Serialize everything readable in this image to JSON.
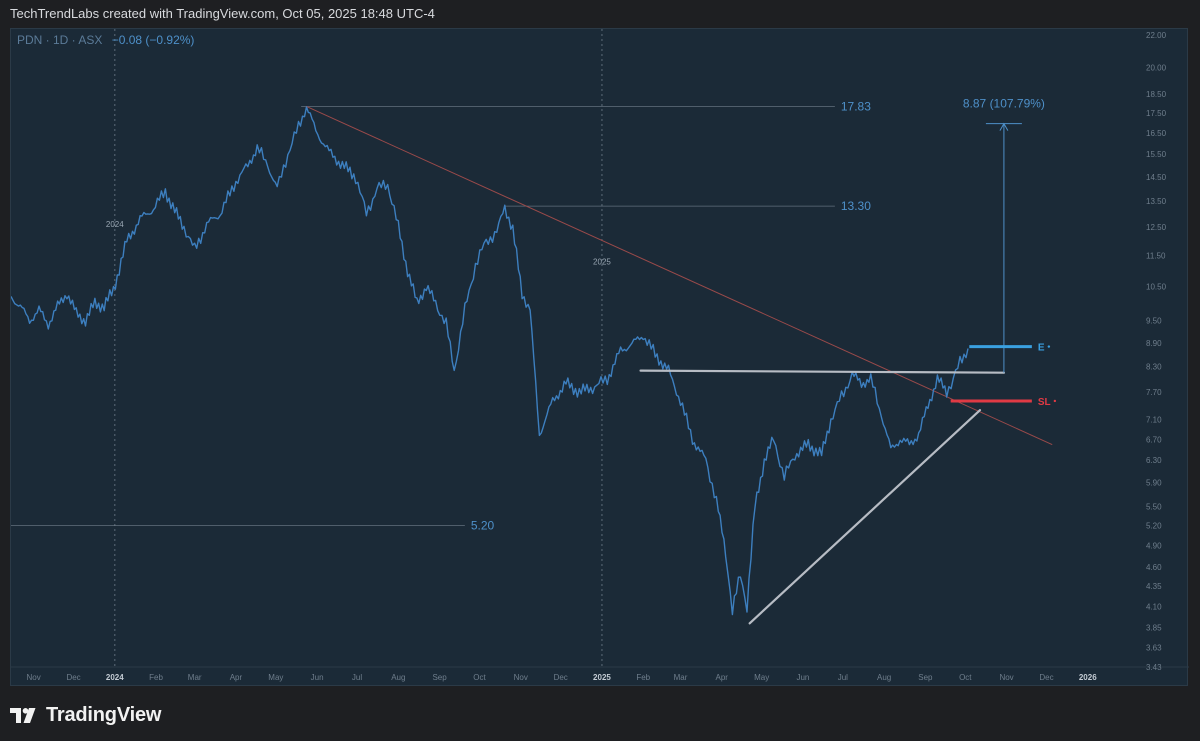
{
  "header": {
    "attribution": "TechTrendLabs created with TradingView.com, Oct 05, 2025 18:48 UTC-4"
  },
  "legend": {
    "symbol": "PDN · 1D · ASX",
    "change": "−0.08 (−0.92%)"
  },
  "brand": {
    "name": "TradingView",
    "icon": "tradingview-logo-icon"
  },
  "colors": {
    "background": "#1b2a37",
    "price_line": "#3d7fbf",
    "accent": "#4e90c9",
    "entry": "#3aa0e0",
    "stop": "#e03a44",
    "trendline": "#9a4a4a",
    "pattern_line": "#b7bcc4"
  },
  "chart_data": {
    "type": "line",
    "symbol": "PDN",
    "interval": "1D",
    "exchange": "ASX",
    "y_scale": "log",
    "ylim": [
      3.43,
      22.0
    ],
    "xlim": [
      "2023-10-15",
      "2026-02-10"
    ],
    "y_ticks": [
      3.43,
      3.63,
      3.85,
      4.1,
      4.35,
      4.6,
      4.9,
      5.2,
      5.5,
      5.9,
      6.3,
      6.7,
      7.1,
      7.7,
      8.3,
      8.9,
      9.5,
      10.5,
      11.5,
      12.5,
      13.5,
      14.5,
      15.5,
      16.5,
      17.5,
      18.5,
      20.0,
      22.0
    ],
    "y_tick_labels": [
      "3.43",
      "3.63",
      "3.85",
      "4.10",
      "4.35",
      "4.60",
      "4.90",
      "5.20",
      "5.50",
      "5.90",
      "6.30",
      "6.70",
      "7.10",
      "7.70",
      "8.30",
      "8.90",
      "9.50",
      "10.50",
      "11.50",
      "12.50",
      "13.50",
      "14.50",
      "15.50",
      "16.50",
      "17.50",
      "18.50",
      "20.00",
      "22.00"
    ],
    "x_ticks": [
      {
        "date": "2023-11-01",
        "label": "Nov"
      },
      {
        "date": "2023-12-01",
        "label": "Dec"
      },
      {
        "date": "2024-01-01",
        "label": "2024"
      },
      {
        "date": "2024-02-01",
        "label": "Feb"
      },
      {
        "date": "2024-03-01",
        "label": "Mar"
      },
      {
        "date": "2024-04-01",
        "label": "Apr"
      },
      {
        "date": "2024-05-01",
        "label": "May"
      },
      {
        "date": "2024-06-01",
        "label": "Jun"
      },
      {
        "date": "2024-07-01",
        "label": "Jul"
      },
      {
        "date": "2024-08-01",
        "label": "Aug"
      },
      {
        "date": "2024-09-01",
        "label": "Sep"
      },
      {
        "date": "2024-10-01",
        "label": "Oct"
      },
      {
        "date": "2024-11-01",
        "label": "Nov"
      },
      {
        "date": "2024-12-01",
        "label": "Dec"
      },
      {
        "date": "2025-01-01",
        "label": "2025"
      },
      {
        "date": "2025-02-01",
        "label": "Feb"
      },
      {
        "date": "2025-03-01",
        "label": "Mar"
      },
      {
        "date": "2025-04-01",
        "label": "Apr"
      },
      {
        "date": "2025-05-01",
        "label": "May"
      },
      {
        "date": "2025-06-01",
        "label": "Jun"
      },
      {
        "date": "2025-07-01",
        "label": "Jul"
      },
      {
        "date": "2025-08-01",
        "label": "Aug"
      },
      {
        "date": "2025-09-01",
        "label": "Sep"
      },
      {
        "date": "2025-10-01",
        "label": "Oct"
      },
      {
        "date": "2025-11-01",
        "label": "Nov"
      },
      {
        "date": "2025-12-01",
        "label": "Dec"
      },
      {
        "date": "2026-01-01",
        "label": "2026"
      }
    ],
    "year_markers": [
      {
        "date": "2024-01-01",
        "label": "2024",
        "price": 12.5
      },
      {
        "date": "2025-01-01",
        "label": "2025",
        "price": 11.2
      }
    ],
    "series": [
      {
        "points": [
          [
            "2023-10-15",
            10.2
          ],
          [
            "2023-10-22",
            9.9
          ],
          [
            "2023-10-29",
            9.5
          ],
          [
            "2023-11-05",
            9.8
          ],
          [
            "2023-11-12",
            9.4
          ],
          [
            "2023-11-19",
            9.9
          ],
          [
            "2023-11-26",
            10.3
          ],
          [
            "2023-12-03",
            9.7
          ],
          [
            "2023-12-10",
            9.5
          ],
          [
            "2023-12-17",
            10.0
          ],
          [
            "2023-12-24",
            9.9
          ],
          [
            "2023-12-31",
            10.4
          ],
          [
            "2024-01-10",
            12.0
          ],
          [
            "2024-01-20",
            12.8
          ],
          [
            "2024-01-30",
            13.2
          ],
          [
            "2024-02-08",
            13.9
          ],
          [
            "2024-02-15",
            13.1
          ],
          [
            "2024-02-22",
            12.5
          ],
          [
            "2024-03-01",
            11.7
          ],
          [
            "2024-03-10",
            12.6
          ],
          [
            "2024-03-20",
            13.0
          ],
          [
            "2024-04-01",
            14.3
          ],
          [
            "2024-04-10",
            15.0
          ],
          [
            "2024-04-17",
            15.8
          ],
          [
            "2024-04-25",
            15.0
          ],
          [
            "2024-05-02",
            14.0
          ],
          [
            "2024-05-10",
            15.5
          ],
          [
            "2024-05-18",
            16.8
          ],
          [
            "2024-05-24",
            17.83
          ],
          [
            "2024-05-31",
            16.6
          ],
          [
            "2024-06-10",
            15.6
          ],
          [
            "2024-06-20",
            15.0
          ],
          [
            "2024-06-30",
            14.5
          ],
          [
            "2024-07-08",
            13.0
          ],
          [
            "2024-07-16",
            14.0
          ],
          [
            "2024-07-24",
            14.2
          ],
          [
            "2024-08-01",
            12.5
          ],
          [
            "2024-08-08",
            11.0
          ],
          [
            "2024-08-15",
            10.0
          ],
          [
            "2024-08-22",
            10.5
          ],
          [
            "2024-08-29",
            10.0
          ],
          [
            "2024-09-06",
            9.4
          ],
          [
            "2024-09-12",
            8.2
          ],
          [
            "2024-09-20",
            9.8
          ],
          [
            "2024-09-28",
            11.2
          ],
          [
            "2024-10-06",
            12.0
          ],
          [
            "2024-10-14",
            12.3
          ],
          [
            "2024-10-20",
            13.3
          ],
          [
            "2024-10-26",
            12.4
          ],
          [
            "2024-11-02",
            10.3
          ],
          [
            "2024-11-08",
            9.8
          ],
          [
            "2024-11-15",
            6.8
          ],
          [
            "2024-11-25",
            7.5
          ],
          [
            "2024-12-05",
            7.9
          ],
          [
            "2024-12-15",
            7.7
          ],
          [
            "2024-12-25",
            7.8
          ],
          [
            "2025-01-05",
            8.0
          ],
          [
            "2025-01-15",
            8.7
          ],
          [
            "2025-01-25",
            8.9
          ],
          [
            "2025-02-01",
            9.1
          ],
          [
            "2025-02-10",
            8.6
          ],
          [
            "2025-02-20",
            8.2
          ],
          [
            "2025-03-01",
            7.5
          ],
          [
            "2025-03-10",
            6.7
          ],
          [
            "2025-03-20",
            6.3
          ],
          [
            "2025-03-28",
            5.6
          ],
          [
            "2025-04-04",
            4.8
          ],
          [
            "2025-04-09",
            4.05
          ],
          [
            "2025-04-15",
            4.5
          ],
          [
            "2025-04-20",
            4.1
          ],
          [
            "2025-04-26",
            5.5
          ],
          [
            "2025-05-03",
            6.3
          ],
          [
            "2025-05-10",
            6.7
          ],
          [
            "2025-05-18",
            6.0
          ],
          [
            "2025-05-26",
            6.4
          ],
          [
            "2025-06-05",
            6.6
          ],
          [
            "2025-06-15",
            6.4
          ],
          [
            "2025-06-22",
            7.1
          ],
          [
            "2025-06-30",
            7.6
          ],
          [
            "2025-07-08",
            8.1
          ],
          [
            "2025-07-15",
            7.9
          ],
          [
            "2025-07-22",
            8.0
          ],
          [
            "2025-07-30",
            7.2
          ],
          [
            "2025-08-06",
            6.5
          ],
          [
            "2025-08-13",
            6.7
          ],
          [
            "2025-08-20",
            6.6
          ],
          [
            "2025-08-27",
            6.8
          ],
          [
            "2025-09-03",
            7.4
          ],
          [
            "2025-09-10",
            8.0
          ],
          [
            "2025-09-17",
            7.7
          ],
          [
            "2025-09-22",
            8.0
          ],
          [
            "2025-09-27",
            8.4
          ],
          [
            "2025-10-03",
            8.75
          ]
        ]
      }
    ],
    "horizontal_levels": [
      {
        "price": 17.83,
        "label": "17.83",
        "from": "2024-05-20",
        "to": "2025-06-25"
      },
      {
        "price": 13.3,
        "label": "13.30",
        "from": "2024-10-20",
        "to": "2025-06-25"
      },
      {
        "price": 5.2,
        "label": "5.20",
        "from": "2023-10-15",
        "to": "2024-09-20"
      }
    ],
    "trendlines": [
      {
        "name": "descending-trendline",
        "from": [
          "2024-05-24",
          17.83
        ],
        "to": [
          "2025-12-05",
          6.6
        ]
      },
      {
        "name": "neckline",
        "from": [
          "2025-01-30",
          8.2
        ],
        "to": [
          "2025-10-30",
          8.15
        ]
      },
      {
        "name": "rising-support",
        "from": [
          "2025-04-22",
          3.9
        ],
        "to": [
          "2025-10-12",
          7.3
        ]
      }
    ],
    "projection": {
      "label": "8.87 (107.79%)",
      "date": "2025-10-30",
      "from_price": 8.15,
      "to_price": 16.95
    },
    "markers": [
      {
        "name": "entry",
        "label": "E",
        "price": 8.8,
        "from": "2025-10-04",
        "to": "2025-11-20"
      },
      {
        "name": "stop-loss",
        "label": "SL",
        "price": 7.5,
        "from": "2025-09-20",
        "to": "2025-11-20"
      }
    ]
  }
}
